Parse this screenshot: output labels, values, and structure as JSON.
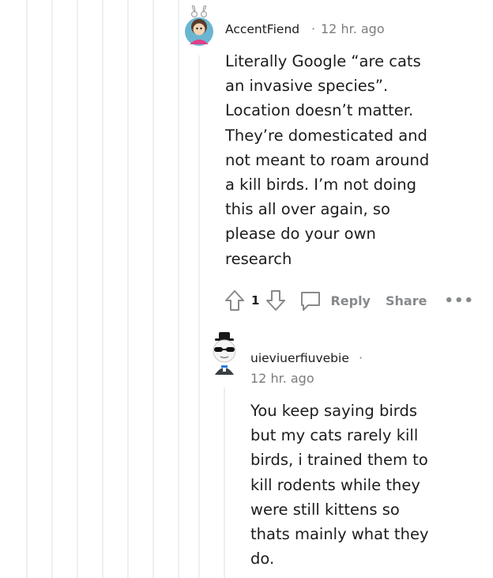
{
  "comments": [
    {
      "author": "AccentFiend",
      "separator": "·",
      "time": "12 hr. ago",
      "body": "Literally Google “are cats an invasive species”. Location doesn’t matter. They’re domesticated and not meant to roam around a kill birds. I’m not doing this all over again, so please do your own research",
      "votes": "1",
      "reply_label": "Reply",
      "share_label": "Share",
      "more_label": "•••"
    },
    {
      "author": "uieviuerfiuvebie",
      "separator": "·",
      "time": "12 hr. ago",
      "body": "You keep saying birds but my cats rarely kill birds, i trained them to kill rodents while they were still kittens so thats mainly what they do."
    }
  ],
  "colors": {
    "thread_line": "#edeff1",
    "meta_text": "#7c7c7c",
    "action_text": "#878a8c"
  },
  "icons": [
    "upvote-arrow-icon",
    "downvote-arrow-icon",
    "comment-bubble-icon",
    "more-options-icon"
  ]
}
